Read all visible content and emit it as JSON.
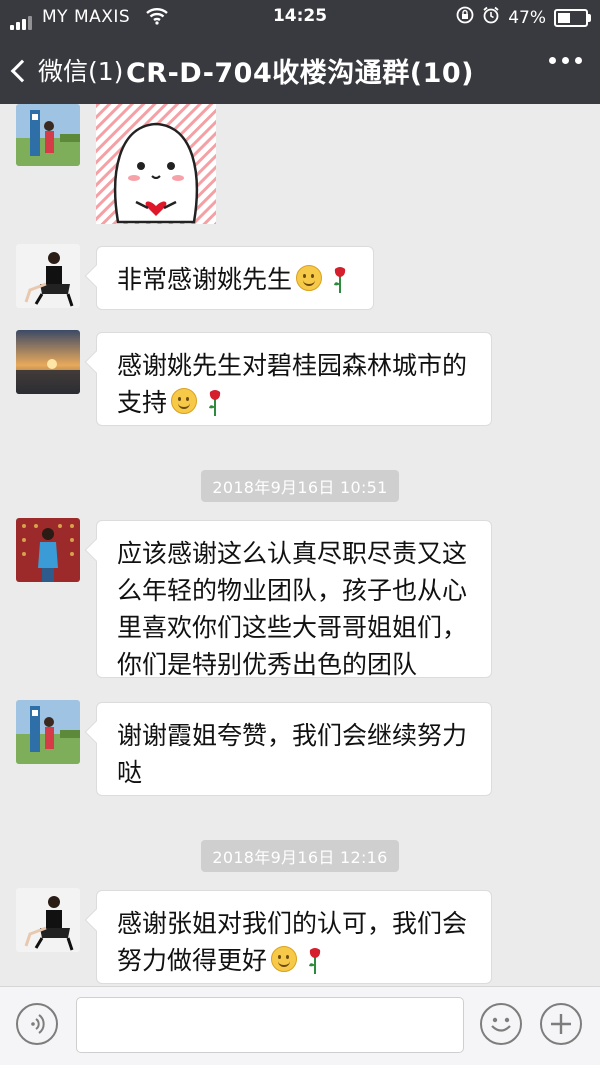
{
  "status_bar": {
    "carrier": "MY MAXIS",
    "time": "14:25",
    "battery": "47%",
    "battery_level": 0.47,
    "icons": [
      "signal-icon",
      "wifi-icon",
      "orientation-lock-icon",
      "alarm-icon",
      "battery-icon"
    ]
  },
  "nav": {
    "back_label": "微信(1)",
    "title": "CR-D-704收楼沟通群(10)"
  },
  "messages": [
    {
      "type": "sticker",
      "avatar": "avatar-landscape-person"
    },
    {
      "text": "非常感谢姚先生",
      "avatar": "avatar-seated-woman",
      "emoji": [
        "smile-emoji",
        "rose-emoji"
      ]
    },
    {
      "text": "感谢姚先生对碧桂园森林城市的支持",
      "avatar": "avatar-sunset",
      "emoji": [
        "smile-emoji",
        "rose-emoji"
      ]
    },
    {
      "type": "timestamp",
      "text": "2018年9月16日 10:51"
    },
    {
      "text": "应该感谢这么认真尽职尽责又这么年轻的物业团队，孩子也从心里喜欢你们这些大哥哥姐姐们，你们是特别优秀出色的团队",
      "avatar": "avatar-red-wall-person"
    },
    {
      "text": "谢谢霞姐夸赞，我们会继续努力哒",
      "avatar": "avatar-landscape-person"
    },
    {
      "type": "timestamp",
      "text": "2018年9月16日 12:16"
    },
    {
      "text": "感谢张姐对我们的认可，我们会努力做得更好",
      "avatar": "avatar-seated-woman",
      "emoji": [
        "smile-emoji",
        "rose-emoji"
      ]
    }
  ],
  "input_bar": {
    "icons": [
      "voice-icon",
      "emoji-icon",
      "plus-icon"
    ]
  },
  "colors": {
    "nav_bg": "#393a3f",
    "chat_bg": "#ebebeb",
    "bubble_bg": "#ffffff",
    "timestamp_bg": "#cfcfcf"
  }
}
